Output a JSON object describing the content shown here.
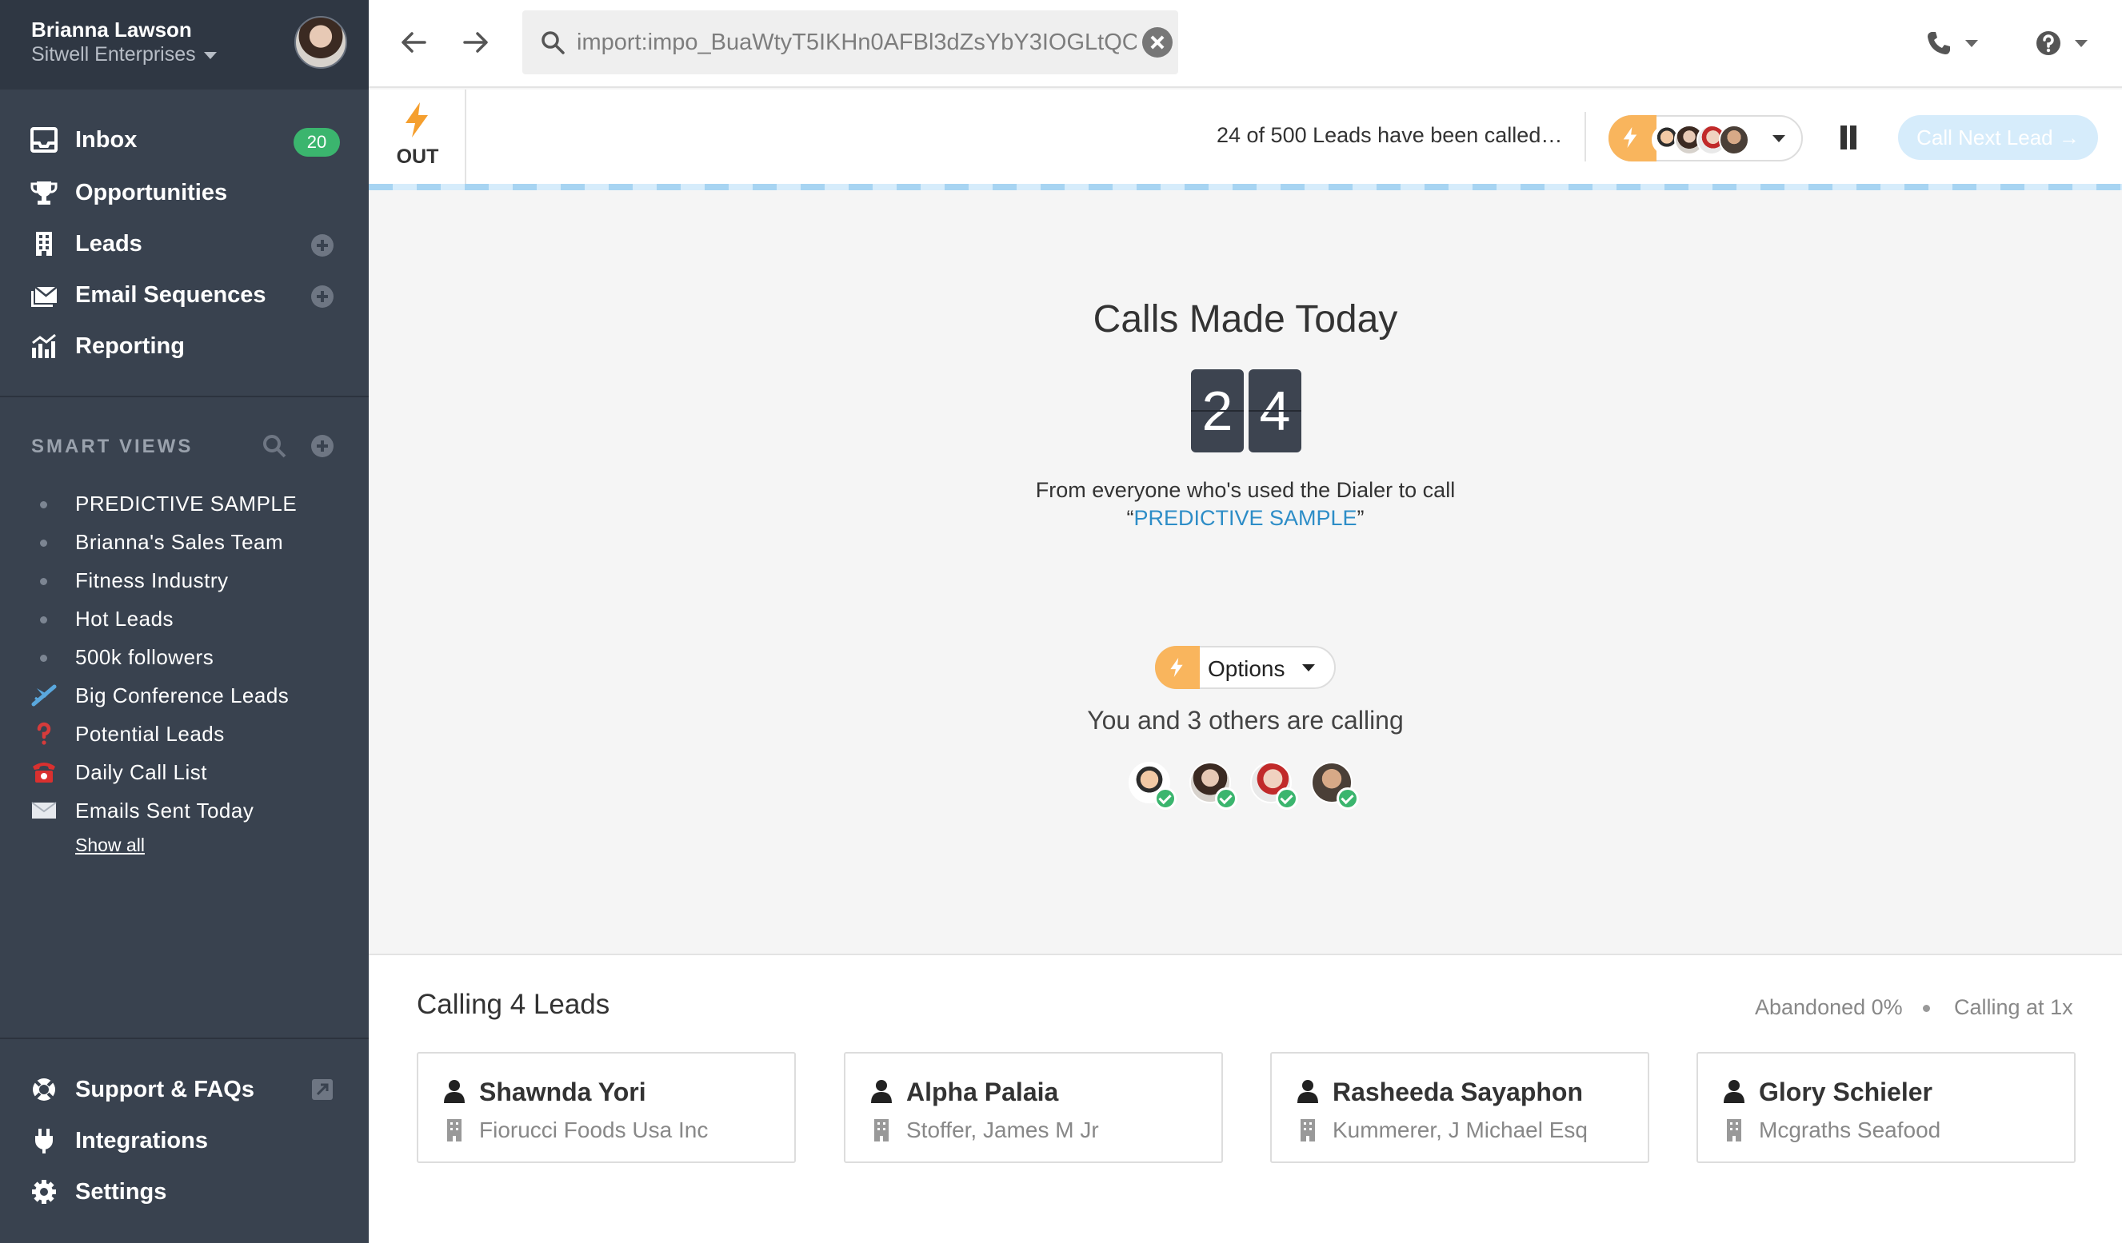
{
  "user": {
    "name": "Brianna Lawson",
    "org": "Sitwell Enterprises"
  },
  "nav": {
    "items": [
      {
        "label": "Inbox",
        "icon": "inbox-icon",
        "badge": "20"
      },
      {
        "label": "Opportunities",
        "icon": "trophy-icon"
      },
      {
        "label": "Leads",
        "icon": "building-icon"
      },
      {
        "label": "Email Sequences",
        "icon": "envelope-icon"
      },
      {
        "label": "Reporting",
        "icon": "bar-chart-icon"
      }
    ]
  },
  "smart_views": {
    "title": "SMART VIEWS",
    "items": [
      {
        "label": "PREDICTIVE SAMPLE",
        "marker": "bullet"
      },
      {
        "label": "Brianna's Sales Team",
        "marker": "bullet"
      },
      {
        "label": "Fitness Industry",
        "marker": "bullet"
      },
      {
        "label": "Hot Leads",
        "marker": "bullet"
      },
      {
        "label": "500k followers",
        "marker": "bullet"
      },
      {
        "label": "Big Conference Leads",
        "marker": "airplane-icon"
      },
      {
        "label": "Potential Leads",
        "marker": "question-mark-icon"
      },
      {
        "label": "Daily Call List",
        "marker": "telephone-icon"
      },
      {
        "label": "Emails Sent Today",
        "marker": "envelope-icon"
      }
    ],
    "show_all": "Show all"
  },
  "footer_nav": [
    {
      "label": "Support & FAQs",
      "icon": "lifebuoy-icon"
    },
    {
      "label": "Integrations",
      "icon": "plug-icon"
    },
    {
      "label": "Settings",
      "icon": "gear-icon"
    }
  ],
  "search": {
    "value": "import:impo_BuaWtyT5IKHn0AFBl3dZsYbY3IOGLtQC"
  },
  "dialer": {
    "direction": "OUT",
    "progress_text": "24 of 500 Leads have been called…",
    "call_next": "Call Next Lead →"
  },
  "main": {
    "title": "Calls Made Today",
    "digits": [
      "2",
      "4"
    ],
    "from_text": "From everyone who's used the Dialer to call",
    "list_open_quote": "“",
    "list_name": "PREDICTIVE SAMPLE",
    "list_close_quote": "”",
    "options_label": "Options",
    "calling_text": "You and 3 others are calling"
  },
  "calling": {
    "heading": "Calling 4 Leads",
    "abandoned": "Abandoned 0%",
    "rate": "Calling at 1x",
    "leads": [
      {
        "name": "Shawnda Yori",
        "company": "Fiorucci Foods Usa Inc"
      },
      {
        "name": "Alpha Palaia",
        "company": "Stoffer, James M Jr"
      },
      {
        "name": "Rasheeda Sayaphon",
        "company": "Kummerer, J Michael Esq"
      },
      {
        "name": "Glory Schieler",
        "company": "Mcgraths Seafood"
      }
    ]
  },
  "colors": {
    "sidebar": "#39424f",
    "accent_orange": "#f9b55d",
    "badge_green": "#3bb56e",
    "link_blue": "#2d8dc7"
  }
}
